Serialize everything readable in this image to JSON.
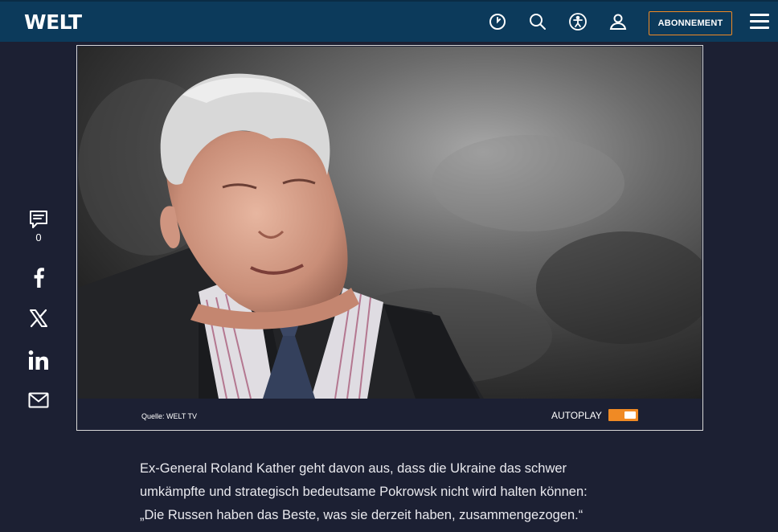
{
  "header": {
    "logo": "WELT",
    "subscribe_label": "ABONNEMENT",
    "icons": [
      "clock-icon",
      "search-icon",
      "accessibility-icon",
      "user-icon",
      "menu-icon"
    ]
  },
  "share": {
    "comment_count": "0",
    "icons": [
      "comment-icon",
      "facebook-icon",
      "x-icon",
      "linkedin-icon",
      "mail-icon"
    ]
  },
  "video": {
    "source": "Quelle: WELT TV",
    "autoplay_label": "AUTOPLAY",
    "autoplay_on": true
  },
  "article": {
    "lines": [
      "Ex-General Roland Kather geht davon aus, dass die Ukraine das schwer",
      "umkämpfte und strategisch bedeutsame Pokrowsk nicht wird halten können:",
      "„Die Russen haben das Beste, was sie derzeit haben, zusammengezogen.“"
    ]
  },
  "colors": {
    "header_bg": "#0c3a5b",
    "page_bg": "#1c2033",
    "accent": "#f08a24"
  }
}
